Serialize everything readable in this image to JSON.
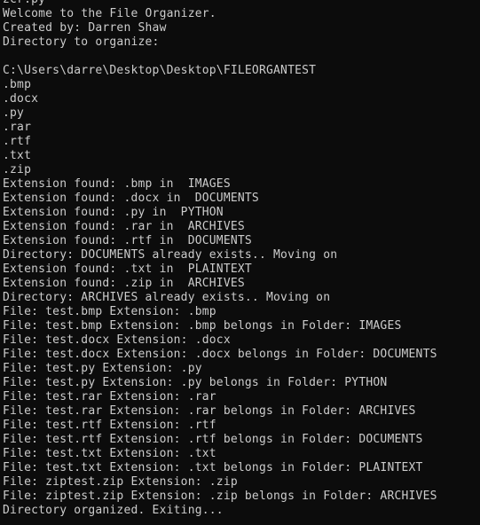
{
  "console": {
    "lines": [
      "zcr.py",
      "Welcome to the File Organizer.",
      "Created by: Darren Shaw",
      "Directory to organize:",
      "",
      "C:\\Users\\darre\\Desktop\\Desktop\\FILEORGANTEST",
      ".bmp",
      ".docx",
      ".py",
      ".rar",
      ".rtf",
      ".txt",
      ".zip",
      "Extension found: .bmp in  IMAGES",
      "Extension found: .docx in  DOCUMENTS",
      "Extension found: .py in  PYTHON",
      "Extension found: .rar in  ARCHIVES",
      "Extension found: .rtf in  DOCUMENTS",
      "Directory: DOCUMENTS already exists.. Moving on",
      "Extension found: .txt in  PLAINTEXT",
      "Extension found: .zip in  ARCHIVES",
      "Directory: ARCHIVES already exists.. Moving on",
      "File: test.bmp Extension: .bmp",
      "File: test.bmp Extension: .bmp belongs in Folder: IMAGES",
      "File: test.docx Extension: .docx",
      "File: test.docx Extension: .docx belongs in Folder: DOCUMENTS",
      "File: test.py Extension: .py",
      "File: test.py Extension: .py belongs in Folder: PYTHON",
      "File: test.rar Extension: .rar",
      "File: test.rar Extension: .rar belongs in Folder: ARCHIVES",
      "File: test.rtf Extension: .rtf",
      "File: test.rtf Extension: .rtf belongs in Folder: DOCUMENTS",
      "File: test.txt Extension: .txt",
      "File: test.txt Extension: .txt belongs in Folder: PLAINTEXT",
      "File: ziptest.zip Extension: .zip",
      "File: ziptest.zip Extension: .zip belongs in Folder: ARCHIVES",
      "Directory organized. Exiting..."
    ]
  },
  "colors": {
    "background": "#0c0c0c",
    "text": "#cccccc"
  }
}
